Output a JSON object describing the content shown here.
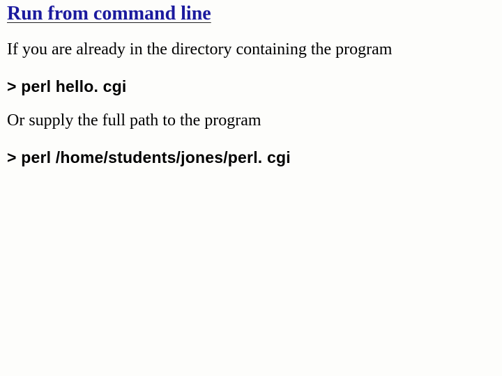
{
  "title": "Run from command line",
  "para1": "If you are already in the directory containing the program",
  "code1": "> perl hello. cgi",
  "para2": "Or supply the full path to the program",
  "code2": "> perl /home/students/jones/perl. cgi"
}
